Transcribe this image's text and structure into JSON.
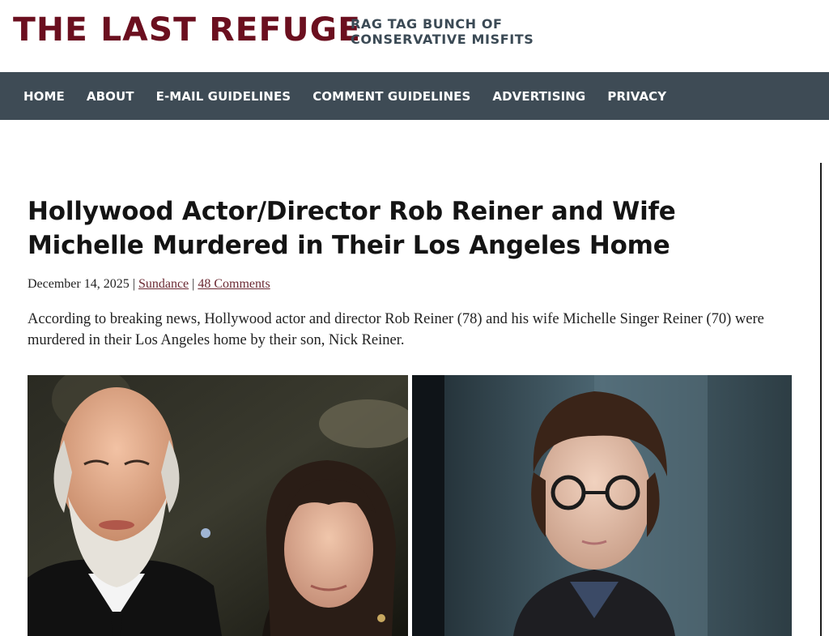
{
  "site": {
    "title": "THE LAST REFUGE",
    "tagline_line1": "RAG TAG BUNCH OF",
    "tagline_line2": "CONSERVATIVE MISFITS"
  },
  "nav": {
    "items": [
      {
        "label": "HOME"
      },
      {
        "label": "ABOUT"
      },
      {
        "label": "E-MAIL GUIDELINES"
      },
      {
        "label": "COMMENT GUIDELINES"
      },
      {
        "label": "ADVERTISING"
      },
      {
        "label": "PRIVACY"
      }
    ]
  },
  "article": {
    "title": "Hollywood Actor/Director Rob Reiner and Wife Michelle Murdered in Their Los Angeles Home",
    "date": "December 14, 2025",
    "author": "Sundance",
    "comments": "48 Comments",
    "separator": "|",
    "lead": "According to breaking news, Hollywood actor and director Rob Reiner (78) and his wife Michelle Singer Reiner (70) were murdered in their Los Angeles home by their son, Nick Reiner."
  },
  "colors": {
    "brand": "#6b0f1f",
    "nav_bg": "#3e4b55",
    "link": "#6b2a33"
  }
}
